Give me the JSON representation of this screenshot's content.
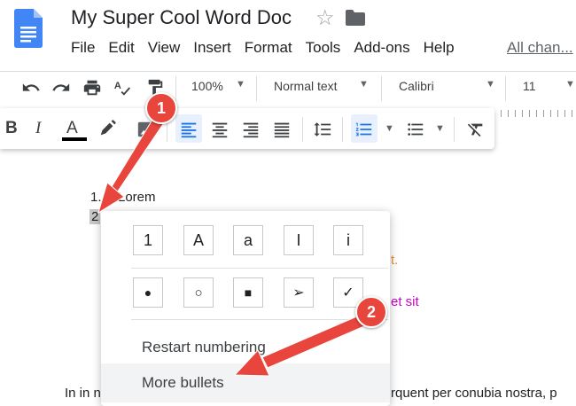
{
  "title": {
    "doc_name": "My Super Cool Word Doc",
    "star_icon": "star-icon",
    "folder_icon": "folder-icon"
  },
  "menubar": {
    "items": [
      "File",
      "Edit",
      "View",
      "Insert",
      "Format",
      "Tools",
      "Add-ons",
      "Help"
    ],
    "all_changes": "All chan..."
  },
  "toolbar": {
    "zoom": "100%",
    "style": "Normal text",
    "font": "Calibri",
    "size": "11"
  },
  "toolbar2": {
    "bold": "B",
    "italic": "I",
    "text_color": "A"
  },
  "document": {
    "item1_num": "1.",
    "item1_text": "Lorem",
    "item2_num": "2",
    "orange_text": "t.",
    "magenta_text": "et sit",
    "bottom_left": "In in n",
    "bottom_right": "rquent per conubia nostra, p"
  },
  "bullet_menu": {
    "number_styles": [
      "1",
      "A",
      "a",
      "I",
      "i"
    ],
    "bullet_styles": [
      "●",
      "○",
      "■",
      "➢",
      "✓"
    ],
    "restart": "Restart numbering",
    "more": "More bullets"
  },
  "callouts": {
    "first": "1",
    "second": "2"
  },
  "colors": {
    "accent": "#e8453c",
    "active_blue": "#1a73e8",
    "doc_blue": "#4285f4"
  }
}
